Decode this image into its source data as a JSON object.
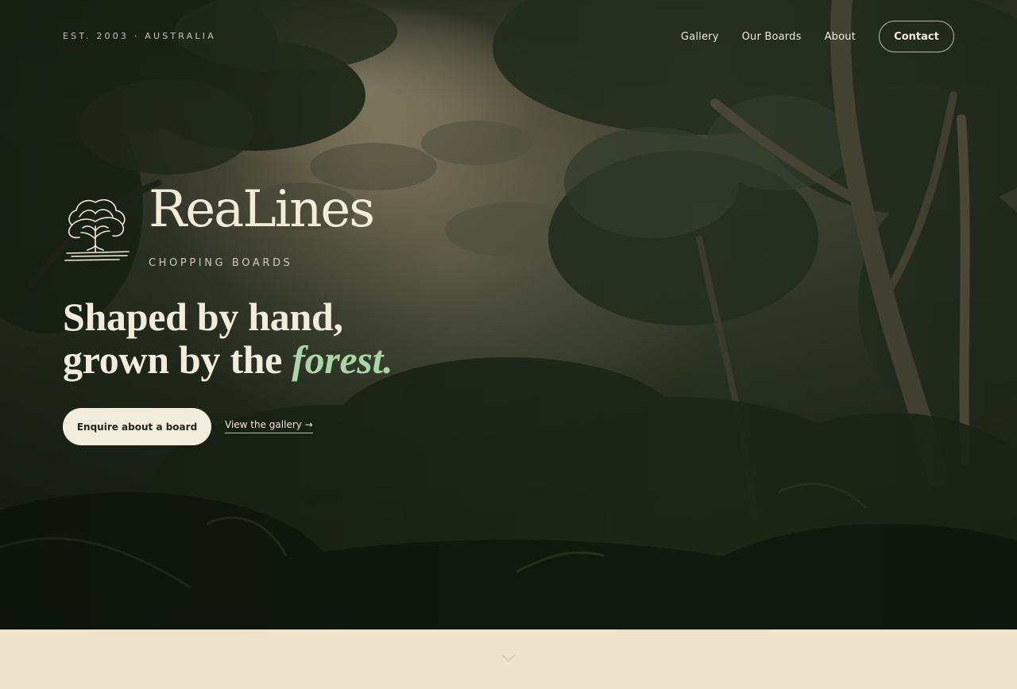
{
  "header": {
    "eyebrow": "EST. 2003 · AUSTRALIA",
    "nav": [
      {
        "label": "Gallery"
      },
      {
        "label": "Our Boards"
      },
      {
        "label": "About"
      }
    ],
    "contact_label": "Contact"
  },
  "brand": {
    "name": "ReaLines",
    "tagline": "CHOPPING BOARDS",
    "logo_icon": "tree-icon"
  },
  "hero": {
    "headline_line1": "Shaped by hand,",
    "headline_line2_prefix": "grown by the ",
    "headline_accent": "forest.",
    "primary_cta": "Enquire about a board",
    "secondary_cta": "View the gallery →"
  },
  "scroll_icon": "chevron-down-icon",
  "colors": {
    "cream": "#f2ecdd",
    "accent_green": "#a9d6a4",
    "section_bg": "#efe3cc",
    "forest_dark": "#1b2317"
  }
}
